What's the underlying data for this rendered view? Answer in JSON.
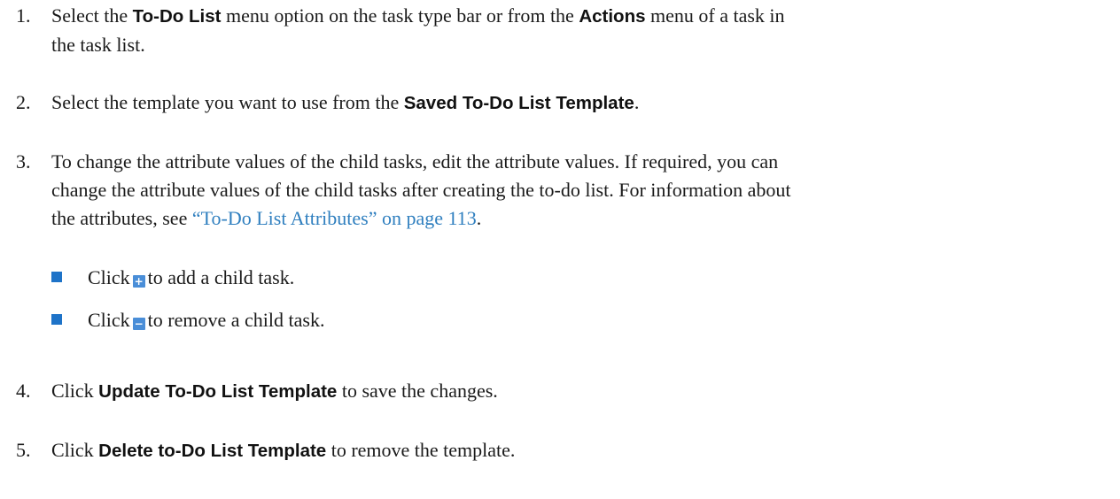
{
  "steps": [
    {
      "number": "1.",
      "t1": "Select the ",
      "b1": "To-Do List",
      "t2": " menu option on the task type bar or from the ",
      "b2": "Actions",
      "t3": " menu of a task in",
      "t4": "the task list."
    },
    {
      "number": "2.",
      "t1": "Select the template you want to use from the ",
      "b1": "Saved To-Do List Template",
      "t2": "."
    },
    {
      "number": "3.",
      "l1": "To change the attribute values of the child tasks, edit the attribute values. If required, you can",
      "l2": "change the attribute values of the child tasks after creating the to-do list. For information about",
      "l3a": "the attributes, see ",
      "link": "“To-Do List Attributes” on page 113",
      "l3b": "."
    },
    {
      "number": "4.",
      "t1": "Click ",
      "b1": "Update To-Do List Template",
      "t2": " to save the changes."
    },
    {
      "number": "5.",
      "t1": "Click ",
      "b1": "Delete to-Do List Template",
      "t2": " to remove the template."
    }
  ],
  "bullets": [
    {
      "before": "Click",
      "icon": "add-row-icon",
      "icon_glyph": "+",
      "after": "to add a child task."
    },
    {
      "before": "Click",
      "icon": "remove-row-icon",
      "icon_glyph": "−",
      "after": "to remove a child task."
    }
  ],
  "colors": {
    "link": "#2f7fbf",
    "bullet_marker": "#1e73c8",
    "inline_icon": "#4a8ed8"
  }
}
